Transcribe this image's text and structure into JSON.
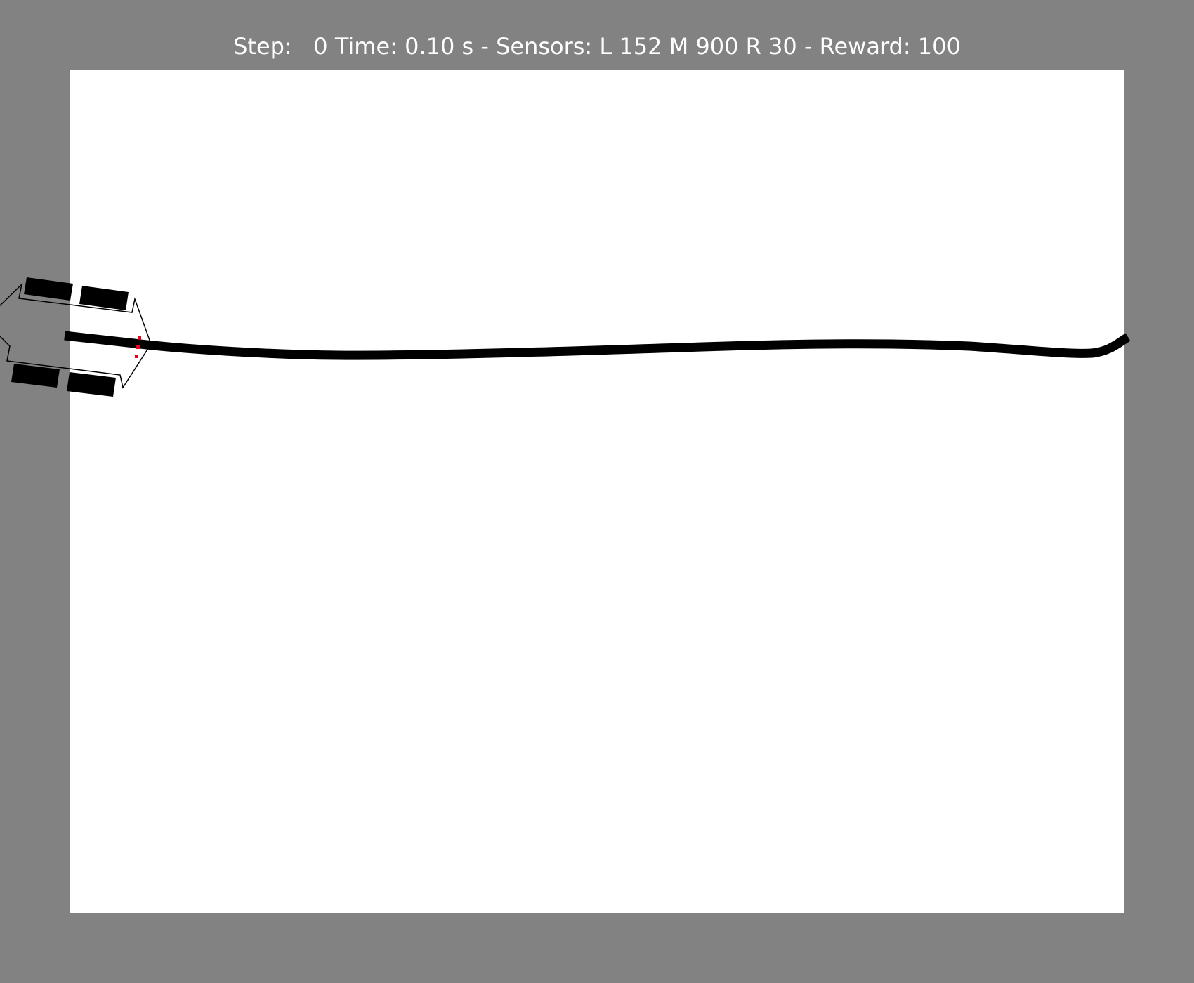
{
  "status": {
    "step_label": "Step:",
    "step_value": "   0",
    "time_label": "Time:",
    "time_value": "0.10 s",
    "separator": "-",
    "sensors_label": "Sensors:",
    "left_label": "L",
    "left_value": "152",
    "middle_label": "M",
    "middle_value": "900",
    "right_label": "R",
    "right_value": "30",
    "reward_label": "Reward:",
    "reward_value": "100"
  },
  "colors": {
    "background": "#828282",
    "arena": "#ffffff",
    "track": "#000000",
    "robot_outline": "#000000",
    "wheels": "#000000",
    "sensor_markers": "#e8001c",
    "text": "#ffffff"
  }
}
